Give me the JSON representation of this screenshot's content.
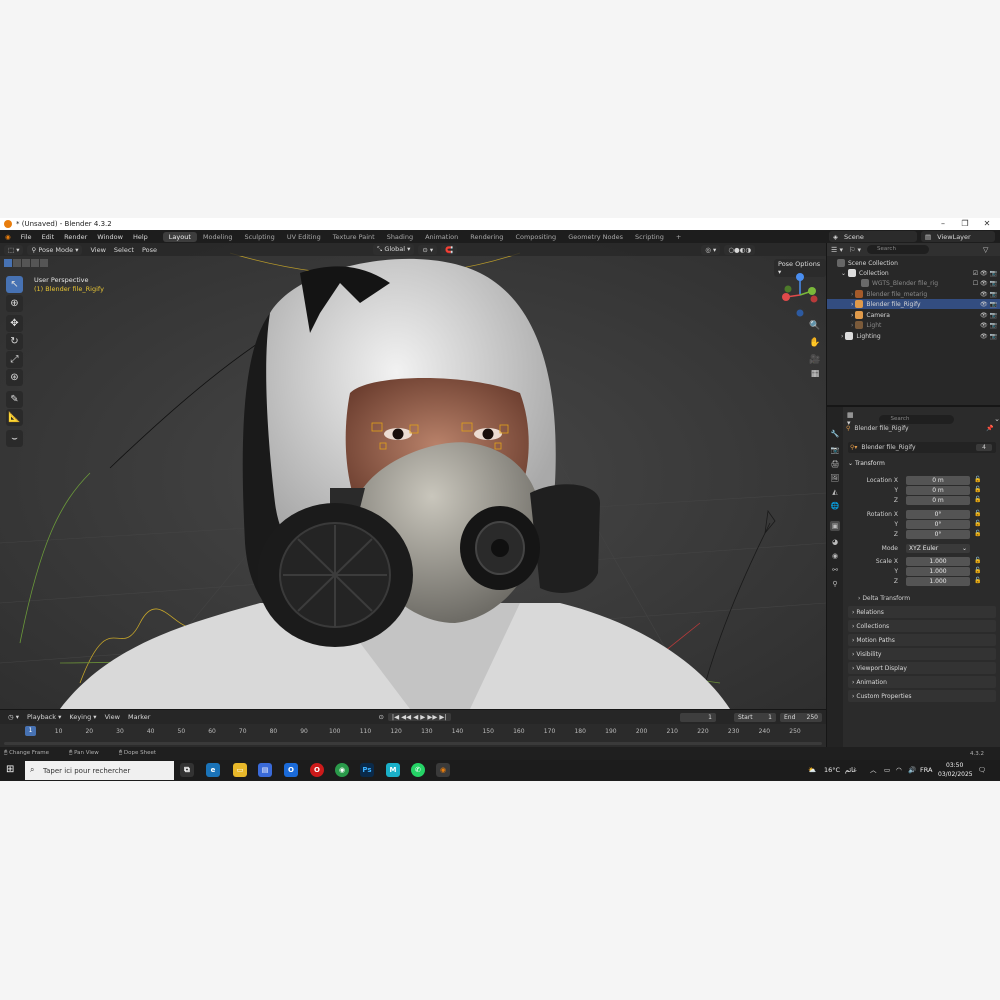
{
  "window": {
    "title": "* (Unsaved) - Blender 4.3.2"
  },
  "menu": {
    "items": [
      "File",
      "Edit",
      "Render",
      "Window",
      "Help"
    ]
  },
  "workspaces": {
    "tabs": [
      "Layout",
      "Modeling",
      "Sculpting",
      "UV Editing",
      "Texture Paint",
      "Shading",
      "Animation",
      "Rendering",
      "Compositing",
      "Geometry Nodes",
      "Scripting"
    ],
    "active": "Layout"
  },
  "scene": {
    "name": "Scene",
    "view_layer": "ViewLayer"
  },
  "viewport": {
    "mode": "Pose Mode",
    "menus": [
      "View",
      "Select",
      "Pose"
    ],
    "orientation": "Global",
    "perspective": "User Perspective",
    "active_object": "(1) Blender file_Rigify",
    "pose_options": "Pose Options",
    "search_placeholder": "Search"
  },
  "outliner": {
    "search_placeholder": "Search",
    "rows": [
      {
        "label": "Scene Collection"
      },
      {
        "label": "Collection"
      },
      {
        "label": "WGTS_Blender file_rig"
      },
      {
        "label": "Blender file_metarig"
      },
      {
        "label": "Blender file_Rigify"
      },
      {
        "label": "Camera"
      },
      {
        "label": "Light"
      },
      {
        "label": "Lighting"
      }
    ]
  },
  "properties": {
    "search_placeholder": "Search",
    "object_name": "Blender file_Rigify",
    "data_name": "Blender file_Rigify",
    "users": "4",
    "transform_header": "Transform",
    "location_label": "Location X",
    "rotation_label": "Rotation X",
    "scale_label": "Scale X",
    "axis_y": "Y",
    "axis_z": "Z",
    "location": [
      "0 m",
      "0 m",
      "0 m"
    ],
    "rotation": [
      "0°",
      "0°",
      "0°"
    ],
    "mode_label": "Mode",
    "mode_value": "XYZ Euler",
    "scale": [
      "1.000",
      "1.000",
      "1.000"
    ],
    "delta_transform": "Delta Transform",
    "sections": [
      "Relations",
      "Collections",
      "Motion Paths",
      "Visibility",
      "Viewport Display",
      "Animation",
      "Custom Properties"
    ]
  },
  "timeline": {
    "menus": [
      "Playback",
      "Keying",
      "View",
      "Marker"
    ],
    "current_frame": "1",
    "start_label": "Start",
    "start": "1",
    "end_label": "End",
    "end": "250",
    "ticks": [
      "1",
      "10",
      "20",
      "30",
      "40",
      "50",
      "60",
      "70",
      "80",
      "90",
      "100",
      "110",
      "120",
      "130",
      "140",
      "150",
      "160",
      "170",
      "180",
      "190",
      "200",
      "210",
      "220",
      "230",
      "240",
      "250"
    ]
  },
  "statusbar": {
    "items": [
      "Change Frame",
      "Pan View",
      "Dope Sheet"
    ],
    "version": "4.3.2"
  },
  "taskbar": {
    "search_placeholder": "Taper ici pour rechercher",
    "weather": "16°C",
    "weather_text": "غائم",
    "language": "FRA",
    "time": "03:50",
    "date": "03/02/2025"
  },
  "colors": {
    "accent": "#4772b3",
    "selection": "#334d80",
    "active_text": "#e8c534"
  }
}
